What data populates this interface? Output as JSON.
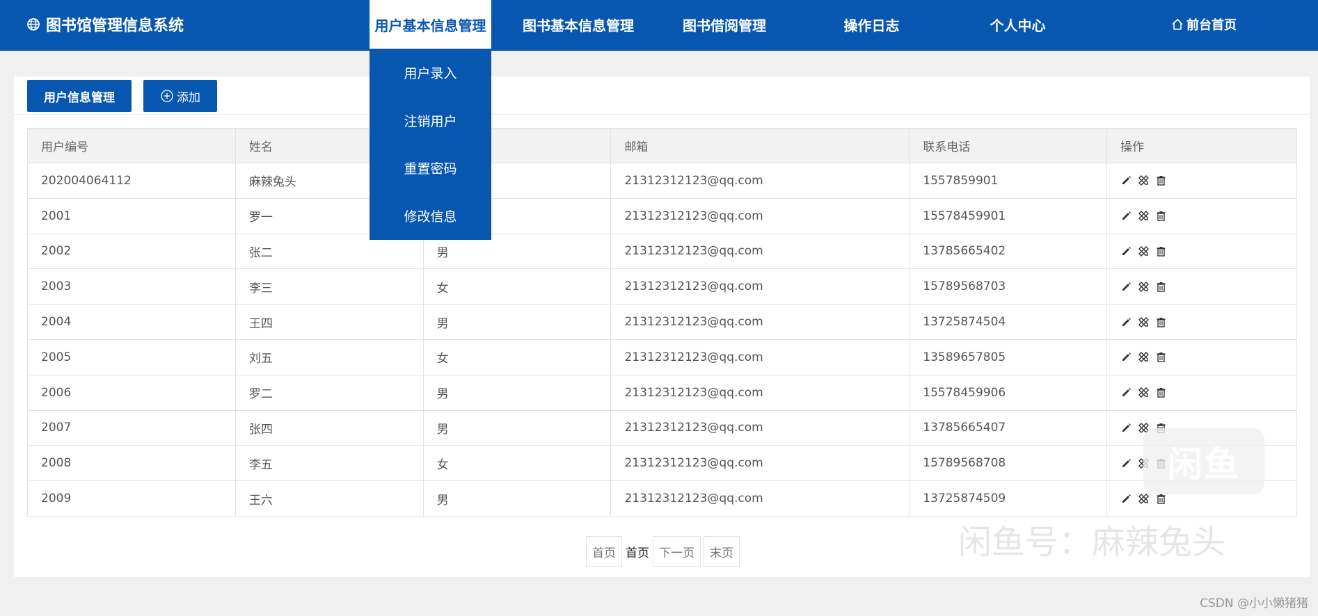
{
  "header": {
    "brand": "图书馆管理信息系统",
    "nav": [
      {
        "label": "用户基本信息管理",
        "active": true
      },
      {
        "label": "图书基本信息管理",
        "active": false
      },
      {
        "label": "图书借阅管理",
        "active": false
      },
      {
        "label": "操作日志",
        "active": false
      },
      {
        "label": "个人中心",
        "active": false
      }
    ],
    "home_label": "前台首页"
  },
  "dropdown": {
    "items": [
      "用户录入",
      "注销用户",
      "重置密码",
      "修改信息"
    ]
  },
  "toolbar": {
    "title_button": "用户信息管理",
    "add_button": "添加"
  },
  "table": {
    "columns": [
      "用户编号",
      "姓名",
      "",
      "邮箱",
      "联系电话",
      "操作"
    ],
    "rows": [
      {
        "id": "202004064112",
        "name": "麻辣兔头",
        "gender": "",
        "email": "21312312123@qq.com",
        "phone": "1557859901"
      },
      {
        "id": "2001",
        "name": "罗一",
        "gender": "",
        "email": "21312312123@qq.com",
        "phone": "15578459901"
      },
      {
        "id": "2002",
        "name": "张二",
        "gender": "男",
        "email": "21312312123@qq.com",
        "phone": "13785665402"
      },
      {
        "id": "2003",
        "name": "李三",
        "gender": "女",
        "email": "21312312123@qq.com",
        "phone": "15789568703"
      },
      {
        "id": "2004",
        "name": "王四",
        "gender": "男",
        "email": "21312312123@qq.com",
        "phone": "13725874504"
      },
      {
        "id": "2005",
        "name": "刘五",
        "gender": "女",
        "email": "21312312123@qq.com",
        "phone": "13589657805"
      },
      {
        "id": "2006",
        "name": "罗二",
        "gender": "男",
        "email": "21312312123@qq.com",
        "phone": "15578459906"
      },
      {
        "id": "2007",
        "name": "张四",
        "gender": "男",
        "email": "21312312123@qq.com",
        "phone": "13785665407"
      },
      {
        "id": "2008",
        "name": "李五",
        "gender": "女",
        "email": "21312312123@qq.com",
        "phone": "15789568708"
      },
      {
        "id": "2009",
        "name": "王六",
        "gender": "男",
        "email": "21312312123@qq.com",
        "phone": "13725874509"
      }
    ],
    "op_icons": [
      "pencil-icon",
      "tools-icon",
      "trash-icon"
    ]
  },
  "pagination": {
    "first": "首页",
    "current": "首页",
    "next": "下一页",
    "last": "末页"
  },
  "watermarks": {
    "badge": "闲鱼",
    "text": "闲鱼号：麻辣兔头",
    "csdn": "CSDN @小小懒猪猪"
  },
  "colors": {
    "primary": "#0757b0",
    "background": "#f0f0f0"
  }
}
